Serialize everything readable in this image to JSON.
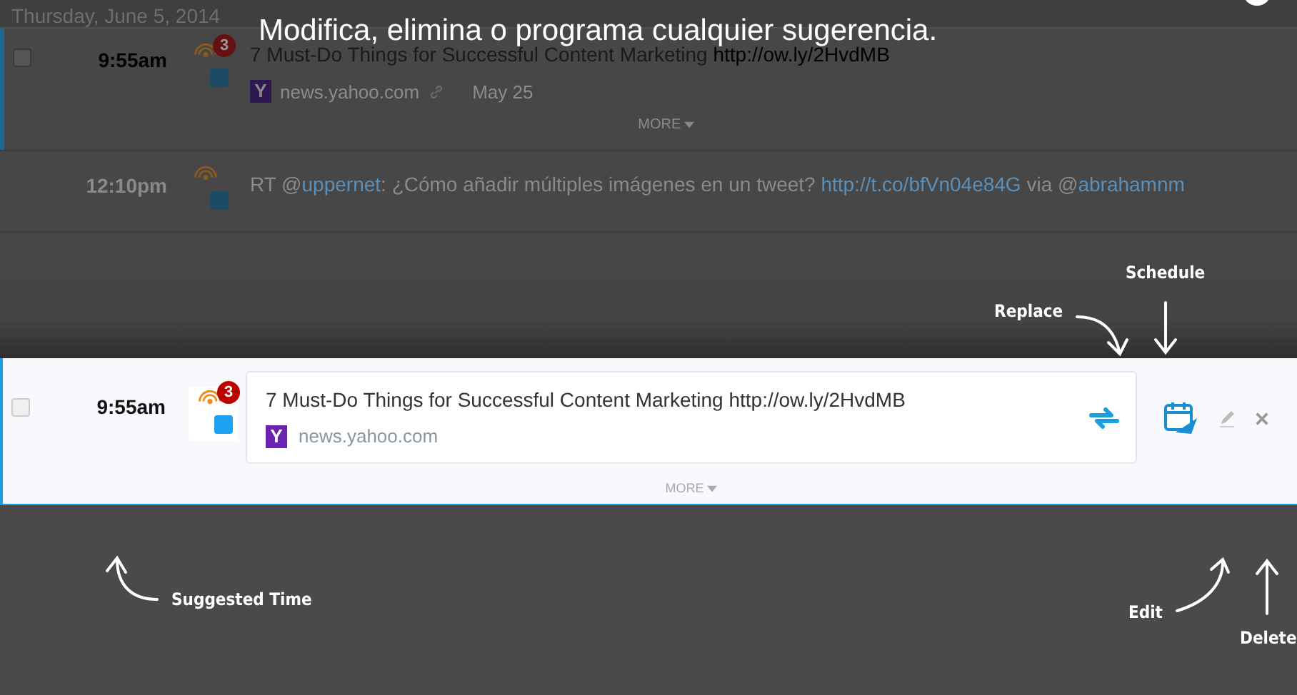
{
  "overlay_message": "Modifica, elimina o programa cualquier sugerencia.",
  "background_list": {
    "date": "Thursday, June 5, 2014",
    "rows": [
      {
        "selected": true,
        "checked": false,
        "time": "9:55am",
        "badge": "3",
        "segments": [
          {
            "kind": "text",
            "text": "7 Must-Do Things for Successful Content Marketing "
          },
          {
            "kind": "url",
            "text": "http://ow.ly/2HvdMB"
          }
        ],
        "source_logo": "Y",
        "source": "news.yahoo.com",
        "date": "May 25",
        "more": "MORE"
      },
      {
        "selected": false,
        "time": "12:10pm",
        "segments": [
          {
            "kind": "text",
            "text": "RT @"
          },
          {
            "kind": "link",
            "text": "uppernet"
          },
          {
            "kind": "text",
            "text": ": ¿Cómo añadir múltiples imágenes en un tweet? "
          },
          {
            "kind": "link",
            "text": "http://t.co/bfVn04e84G"
          },
          {
            "kind": "text",
            "text": " via @"
          },
          {
            "kind": "link",
            "text": "abrahamnm"
          }
        ]
      }
    ]
  },
  "suggestion": {
    "checked": false,
    "time": "9:55am",
    "badge": "3",
    "title": "7 Must-Do Things for Successful Content Marketing http://ow.ly/2HvdMB",
    "source_logo": "Y",
    "source": "news.yahoo.com",
    "more": "MORE"
  },
  "annotations": [
    "Replace",
    "Schedule",
    "Suggested Time",
    "Edit",
    "Delete"
  ]
}
